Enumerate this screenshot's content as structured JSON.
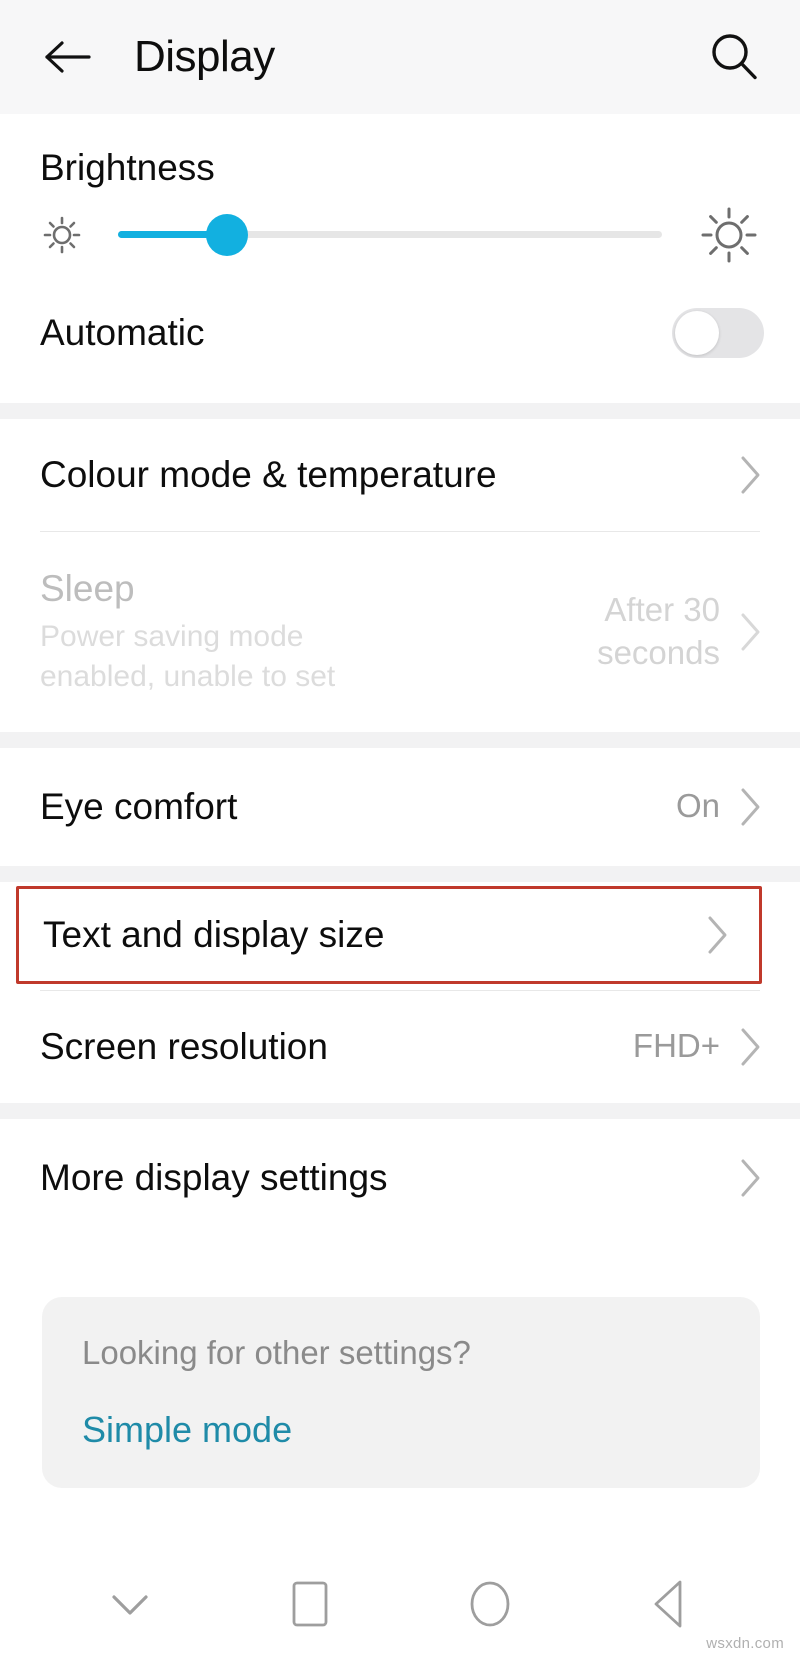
{
  "header": {
    "title": "Display",
    "back_icon": "arrow-left-icon",
    "search_icon": "search-icon"
  },
  "brightness": {
    "title": "Brightness",
    "low_icon": "brightness-low-sun-icon",
    "high_icon": "brightness-high-sun-icon",
    "value_percent": 20,
    "accent_color": "#12b0e0",
    "track_color": "#e6e6e6"
  },
  "automatic": {
    "label": "Automatic",
    "state": "off"
  },
  "colour_mode": {
    "label": "Colour mode & temperature",
    "chevron": "chevron-right-icon"
  },
  "sleep": {
    "label": "Sleep",
    "subtitle": "Power saving mode enabled, unable to set",
    "value": "After 30 seconds",
    "disabled": true,
    "chevron": "chevron-right-icon"
  },
  "eye_comfort": {
    "label": "Eye comfort",
    "value": "On",
    "chevron": "chevron-right-icon"
  },
  "text_display_size": {
    "label": "Text and display size",
    "chevron": "chevron-right-icon",
    "highlight_color": "#c0392b",
    "highlighted": true
  },
  "screen_resolution": {
    "label": "Screen resolution",
    "value": "FHD+",
    "chevron": "chevron-right-icon"
  },
  "more_display_settings": {
    "label": "More display settings",
    "chevron": "chevron-right-icon"
  },
  "footer_card": {
    "title": "Looking for other settings?",
    "link": "Simple mode",
    "link_color": "#1f8ba8"
  },
  "navbar": {
    "items": [
      {
        "icon": "chevron-down-icon",
        "name": "hide-keyboard-button"
      },
      {
        "icon": "square-icon",
        "name": "recents-button"
      },
      {
        "icon": "circle-icon",
        "name": "home-button"
      },
      {
        "icon": "triangle-left-icon",
        "name": "back-button"
      }
    ]
  },
  "watermark": "wsxdn.com"
}
